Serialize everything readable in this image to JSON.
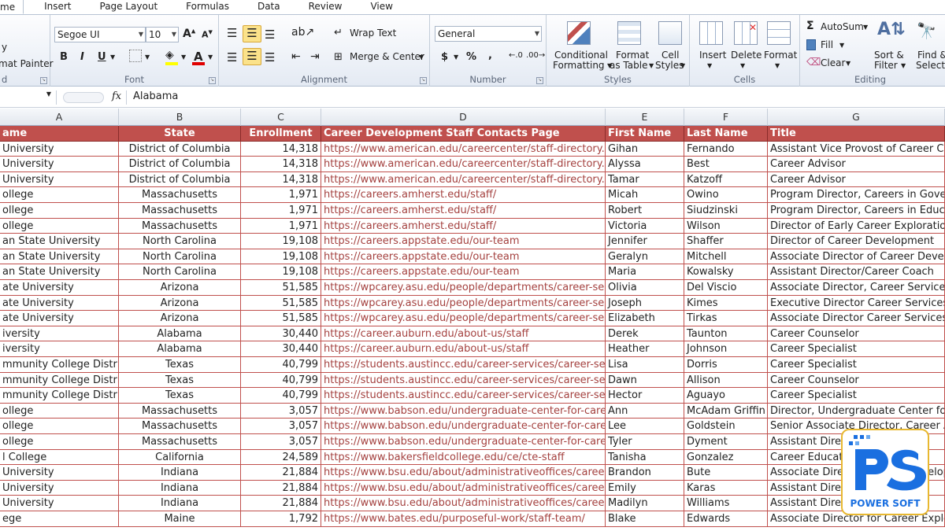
{
  "tabs": [
    "me",
    "Insert",
    "Page Layout",
    "Formulas",
    "Data",
    "Review",
    "View"
  ],
  "ribbon": {
    "clipboard": {
      "copy_partial": "y",
      "format_painter": "mat Painter"
    },
    "font": {
      "name": "Segoe UI",
      "size": "10",
      "label": "Font",
      "bold": "B",
      "italic": "I",
      "underline": "U",
      "grow": "A",
      "shrink": "A",
      "color_letter": "A"
    },
    "alignment": {
      "label": "Alignment",
      "wrap_text": "Wrap Text",
      "merge_center": "Merge & Center"
    },
    "number": {
      "label": "Number",
      "format": "General",
      "currency": "$",
      "percent": "%",
      "comma": ","
    },
    "styles": {
      "label": "Styles",
      "conditional1": "Conditional",
      "conditional2": "Formatting",
      "format_as1": "Format",
      "format_as2": "as Table",
      "cell_styles1": "Cell",
      "cell_styles2": "Styles"
    },
    "cells": {
      "label": "Cells",
      "insert": "Insert",
      "delete": "Delete",
      "format": "Format"
    },
    "editing": {
      "label": "Editing",
      "autosum": "AutoSum",
      "fill": "Fill",
      "clear": "Clear",
      "sort1": "Sort &",
      "sort2": "Filter",
      "find1": "Find &",
      "find2": "Select"
    },
    "clipboard_label": "d"
  },
  "formula_bar": {
    "fx": "fx",
    "value": "Alabama"
  },
  "columns": [
    "A",
    "B",
    "C",
    "D",
    "E",
    "F",
    "G"
  ],
  "headers": [
    "ame",
    "State",
    "Enrollment",
    "Career Development Staff Contacts Page",
    "First Name",
    "Last Name",
    "Title"
  ],
  "rows": [
    [
      "University",
      "District of Columbia",
      "14,318",
      "https://www.american.edu/careercenter/staff-directory.cfm",
      "Gihan",
      "Fernando",
      "Assistant Vice Provost of Career Cent"
    ],
    [
      "University",
      "District of Columbia",
      "14,318",
      "https://www.american.edu/careercenter/staff-directory.cfm",
      "Alyssa",
      "Best",
      "Career Advisor"
    ],
    [
      "University",
      "District of Columbia",
      "14,318",
      "https://www.american.edu/careercenter/staff-directory.cfm",
      "Tamar",
      "Katzoff",
      "Career Advisor"
    ],
    [
      "ollege",
      "Massachusetts",
      "1,971",
      "https://careers.amherst.edu/staff/",
      "Micah",
      "Owino",
      "Program Director, Careers in Governi"
    ],
    [
      "ollege",
      "Massachusetts",
      "1,971",
      "https://careers.amherst.edu/staff/",
      "Robert",
      "Siudzinski",
      "Program Director, Careers in Educatio"
    ],
    [
      "ollege",
      "Massachusetts",
      "1,971",
      "https://careers.amherst.edu/staff/",
      "Victoria",
      "Wilson",
      "Director of Early Career Exploration/P"
    ],
    [
      "an State University",
      "North Carolina",
      "19,108",
      "https://careers.appstate.edu/our-team",
      "Jennifer",
      "Shaffer",
      "Director of Career Development"
    ],
    [
      "an State University",
      "North Carolina",
      "19,108",
      "https://careers.appstate.edu/our-team",
      "Geralyn",
      "Mitchell",
      "Associate Director of Career Develop"
    ],
    [
      "an State University",
      "North Carolina",
      "19,108",
      "https://careers.appstate.edu/our-team",
      "Maria",
      "Kowalsky",
      "Assistant Director/Career Coach"
    ],
    [
      "ate University",
      "Arizona",
      "51,585",
      "https://wpcarey.asu.edu/people/departments/career-service",
      "Olivia",
      "Del Viscio",
      "Associate Director, Career Services"
    ],
    [
      "ate University",
      "Arizona",
      "51,585",
      "https://wpcarey.asu.edu/people/departments/career-service",
      "Joseph",
      "Kimes",
      "Executive Director Career Services"
    ],
    [
      "ate University",
      "Arizona",
      "51,585",
      "https://wpcarey.asu.edu/people/departments/career-service",
      "Elizabeth",
      "Tirkas",
      "Associate Director Career Services"
    ],
    [
      "iversity",
      "Alabama",
      "30,440",
      "https://career.auburn.edu/about-us/staff",
      "Derek",
      "Taunton",
      "Career Counselor"
    ],
    [
      "iversity",
      "Alabama",
      "30,440",
      "https://career.auburn.edu/about-us/staff",
      "Heather",
      "Johnson",
      "Career Specialist"
    ],
    [
      "mmunity College District",
      "Texas",
      "40,799",
      "https://students.austincc.edu/career-services/career-services",
      "Lisa",
      "Dorris",
      "Career Specialist"
    ],
    [
      "mmunity College District",
      "Texas",
      "40,799",
      "https://students.austincc.edu/career-services/career-services",
      "Dawn",
      "Allison",
      "Career Counselor"
    ],
    [
      "mmunity College District",
      "Texas",
      "40,799",
      "https://students.austincc.edu/career-services/career-services",
      "Hector",
      "Aguayo",
      "Career Specialist"
    ],
    [
      "ollege",
      "Massachusetts",
      "3,057",
      "https://www.babson.edu/undergraduate-center-for-career-d",
      "Ann",
      "McAdam Griffin",
      "Director, Undergraduate Center for C"
    ],
    [
      "ollege",
      "Massachusetts",
      "3,057",
      "https://www.babson.edu/undergraduate-center-for-career-d",
      "Lee",
      "Goldstein",
      "Senior Associate Director, Career Adv"
    ],
    [
      "ollege",
      "Massachusetts",
      "3,057",
      "https://www.babson.edu/undergraduate-center-for-career-d",
      "Tyler",
      "Dyment",
      "Assistant Director"
    ],
    [
      "l College",
      "California",
      "24,589",
      "https://www.bakersfieldcollege.edu/ce/cte-staff",
      "Tanisha",
      "Gonzalez",
      "Career Education"
    ],
    [
      "University",
      "Indiana",
      "21,884",
      "https://www.bsu.edu/about/administrativeoffices/careercent",
      "Brandon",
      "Bute",
      "Associate Director, Career Develop"
    ],
    [
      "University",
      "Indiana",
      "21,884",
      "https://www.bsu.edu/about/administrativeoffices/careercent",
      "Emily",
      "Karas",
      "Assistant Director"
    ],
    [
      "University",
      "Indiana",
      "21,884",
      "https://www.bsu.edu/about/administrativeoffices/careercent",
      "Madilyn",
      "Williams",
      "Assistant Director"
    ],
    [
      "ege",
      "Maine",
      "1,792",
      "https://www.bates.edu/purposeful-work/staff-team/",
      "Blake",
      "Edwards",
      "Associate Director for Career Explora"
    ]
  ],
  "logo": {
    "text": "POWER SOFT",
    "mark": "PS"
  },
  "colors": {
    "header_fill": "#c0504d",
    "link": "#a4413f",
    "accent": "#1a6fe0"
  }
}
